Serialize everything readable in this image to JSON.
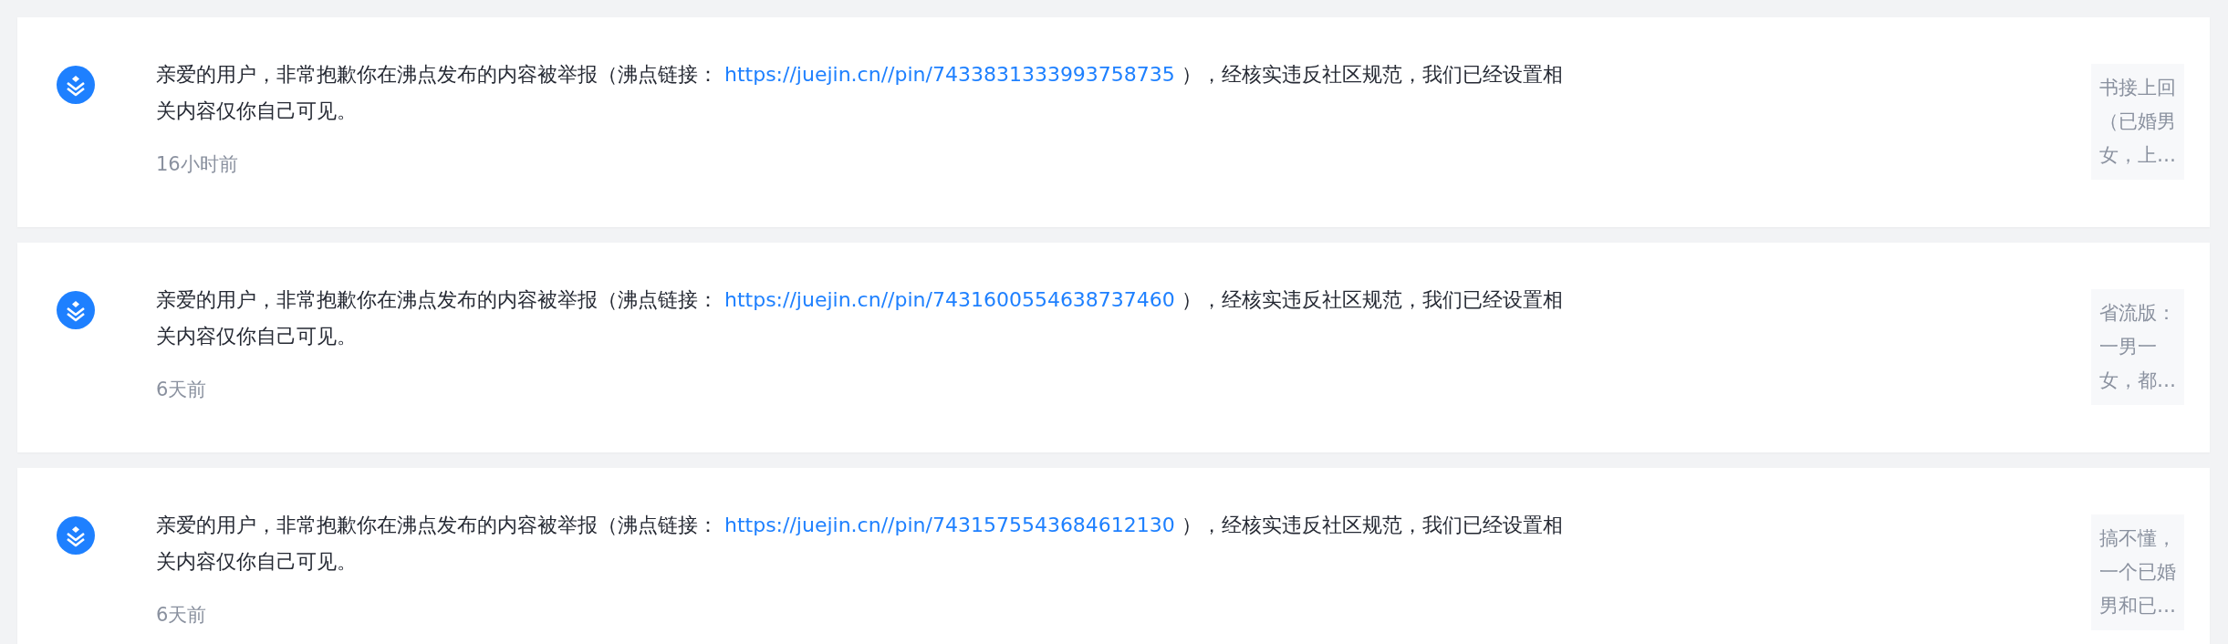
{
  "notifications": [
    {
      "message_before": "亲爱的用户，非常抱歉你在沸点发布的内容被举报（沸点链接：",
      "link": "https://juejin.cn//pin/7433831333993758735",
      "message_after": "），经核实违反社区规范，我们已经设置相关内容仅你自己可见。",
      "time": "16小时前",
      "preview": "书接上回（已婚男女，上…"
    },
    {
      "message_before": "亲爱的用户，非常抱歉你在沸点发布的内容被举报（沸点链接：",
      "link": "https://juejin.cn//pin/7431600554638737460",
      "message_after": "），经核实违反社区规范，我们已经设置相关内容仅你自己可见。",
      "time": "6天前",
      "preview": "省流版：一男一女，都…"
    },
    {
      "message_before": "亲爱的用户，非常抱歉你在沸点发布的内容被举报（沸点链接：",
      "link": "https://juejin.cn//pin/7431575543684612130",
      "message_after": "），经核实违反社区规范，我们已经设置相关内容仅你自己可见。",
      "time": "6天前",
      "preview": "搞不懂，一个已婚男和已…"
    }
  ]
}
